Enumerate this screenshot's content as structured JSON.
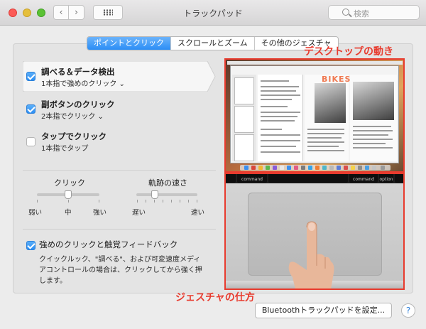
{
  "window": {
    "title": "トラックパッド"
  },
  "search": {
    "placeholder": "検索"
  },
  "tabs": [
    {
      "label": "ポイントとクリック"
    },
    {
      "label": "スクロールとズーム"
    },
    {
      "label": "その他のジェスチャ"
    }
  ],
  "options": [
    {
      "title": "調べる＆データ検出",
      "subtitle": "1本指で強めのクリック ⌄",
      "checked": true
    },
    {
      "title": "副ボタンのクリック",
      "subtitle": "2本指でクリック ⌄",
      "checked": true
    },
    {
      "title": "タップでクリック",
      "subtitle": "1本指でタップ",
      "checked": false
    }
  ],
  "sliders": {
    "click": {
      "label": "クリック",
      "min_label": "弱い",
      "mid_label": "中",
      "max_label": "強い",
      "value_fraction": 0.5
    },
    "tracking": {
      "label": "軌跡の速さ",
      "min_label": "遅い",
      "max_label": "速い",
      "value_fraction": 0.3
    }
  },
  "force_click": {
    "title": "強めのクリックと触覚フィードバック",
    "checked": true,
    "description": "クイックルック、\"調べる\"、および可変速度メディアコントロールの場合は、クリックしてから強く押します。"
  },
  "preview": {
    "heading_text": "BIKES",
    "keys": {
      "left": "command",
      "right": "command",
      "alt_right": "option"
    }
  },
  "annotations": {
    "desktop_label": "デスクトップの動き",
    "gesture_label": "ジェスチャの仕方",
    "color": "#e83b2e"
  },
  "buttons": {
    "bluetooth": "Bluetoothトラックパッドを設定...",
    "help": "?"
  },
  "colors": {
    "accent": "#2b8ef6",
    "annotation": "#e83b2e"
  }
}
